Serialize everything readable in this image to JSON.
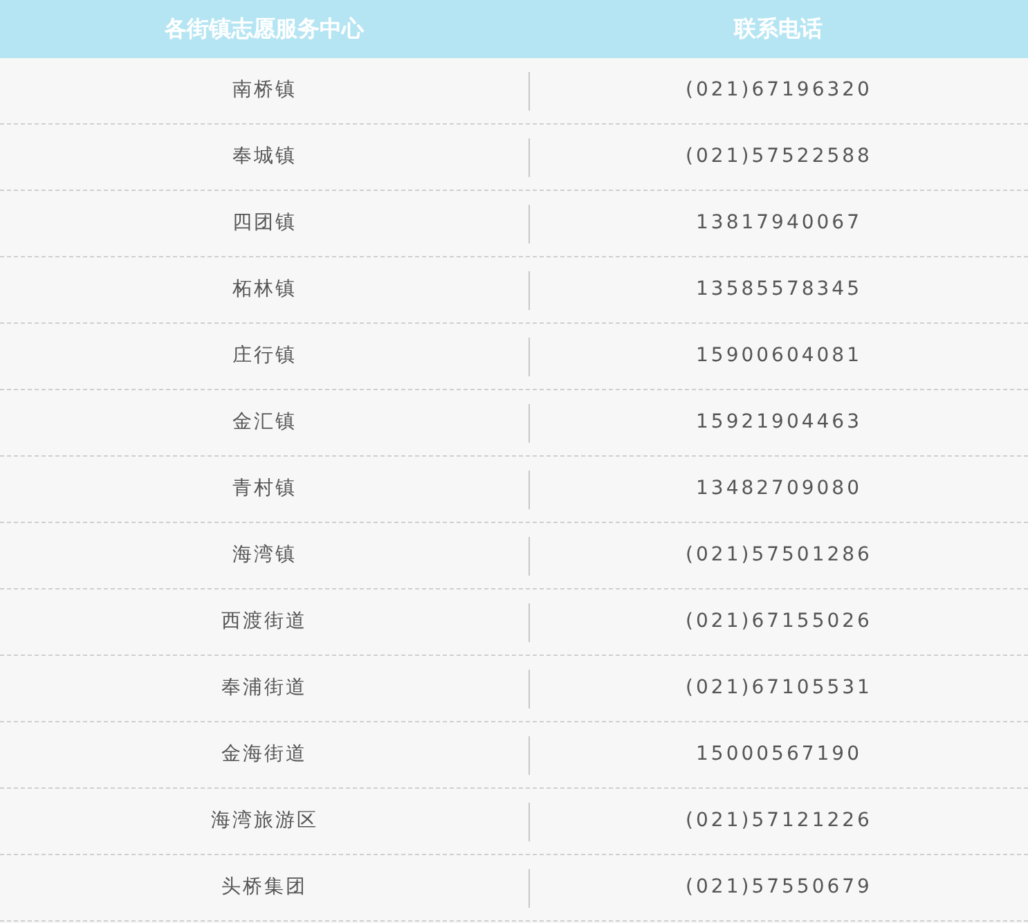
{
  "table": {
    "columns": [
      "各街镇志愿服务中心",
      "联系电话"
    ],
    "rows": [
      {
        "center": "南桥镇",
        "phone": "(021)67196320"
      },
      {
        "center": "奉城镇",
        "phone": "(021)57522588"
      },
      {
        "center": "四团镇",
        "phone": "13817940067"
      },
      {
        "center": "柘林镇",
        "phone": "13585578345"
      },
      {
        "center": "庄行镇",
        "phone": "15900604081"
      },
      {
        "center": "金汇镇",
        "phone": "15921904463"
      },
      {
        "center": "青村镇",
        "phone": "13482709080"
      },
      {
        "center": "海湾镇",
        "phone": "(021)57501286"
      },
      {
        "center": "西渡街道",
        "phone": "(021)67155026"
      },
      {
        "center": "奉浦街道",
        "phone": "(021)67105531"
      },
      {
        "center": "金海街道",
        "phone": "15000567190"
      },
      {
        "center": "海湾旅游区",
        "phone": "(021)57121226"
      },
      {
        "center": "头桥集团",
        "phone": "(021)57550679"
      }
    ]
  }
}
